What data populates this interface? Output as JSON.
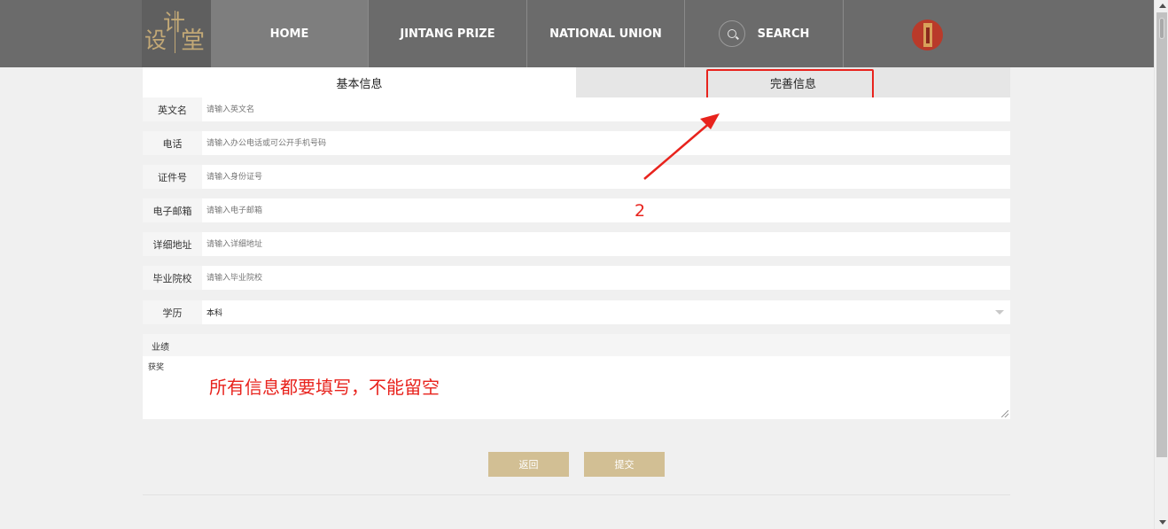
{
  "logo": {
    "chars": [
      "设",
      "计",
      "堂"
    ]
  },
  "nav": {
    "items": [
      {
        "label": "HOME"
      },
      {
        "label": "JINTANG PRIZE"
      },
      {
        "label": "NATIONAL UNION"
      },
      {
        "label": "SEARCH"
      }
    ]
  },
  "tabs": [
    {
      "label": "基本信息",
      "active": true
    },
    {
      "label": "完善信息",
      "active": false
    }
  ],
  "form": {
    "fields": [
      {
        "label": "英文名",
        "placeholder": "请输入英文名"
      },
      {
        "label": "电话",
        "placeholder": "请输入办公电话或可公开手机号码"
      },
      {
        "label": "证件号",
        "placeholder": "请输入身份证号"
      },
      {
        "label": "电子邮箱",
        "placeholder": "请输入电子邮箱"
      },
      {
        "label": "详细地址",
        "placeholder": "请输入详细地址"
      },
      {
        "label": "毕业院校",
        "placeholder": "请输入毕业院校"
      }
    ],
    "education": {
      "label": "学历",
      "value": "本科"
    },
    "performance": {
      "label": "业绩",
      "value": "获奖"
    }
  },
  "annotations": {
    "step_number": "2",
    "note": "所有信息都要填写，不能留空",
    "color": "#e8231d"
  },
  "buttons": {
    "back": "返回",
    "submit": "提交"
  },
  "colors": {
    "nav_bg": "#6b6b6b",
    "nav_active": "#7e7e7e",
    "accent": "#d2bf94",
    "logo": "#c2a876"
  }
}
